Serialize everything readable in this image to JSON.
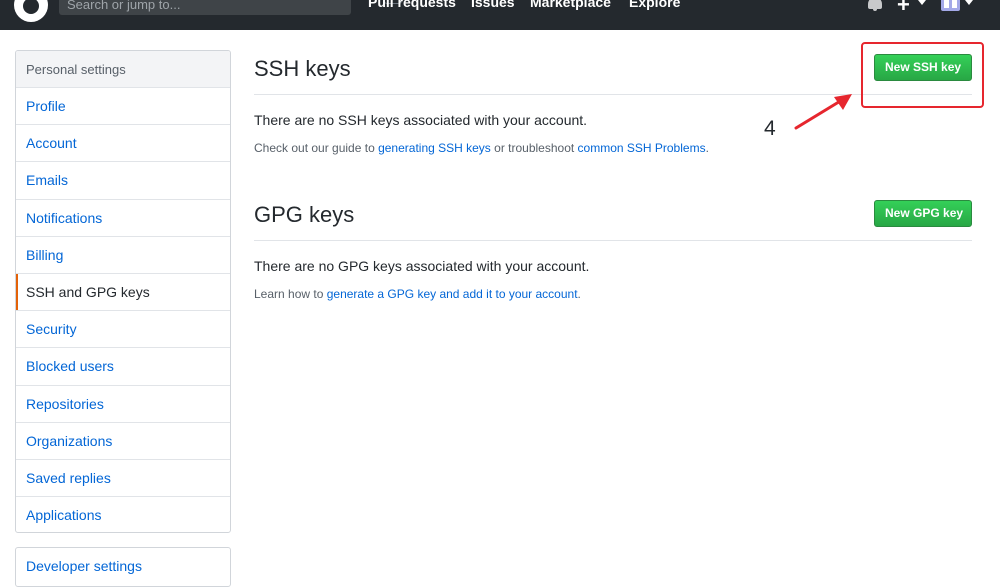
{
  "header": {
    "search": {
      "placeholder": "Search or jump to...",
      "shortcut": "/"
    },
    "nav": [
      "Pull requests",
      "Issues",
      "Marketplace",
      "Explore"
    ]
  },
  "sidebar": {
    "heading": "Personal settings",
    "items": [
      {
        "label": "Profile"
      },
      {
        "label": "Account"
      },
      {
        "label": "Emails"
      },
      {
        "label": "Notifications"
      },
      {
        "label": "Billing"
      },
      {
        "label": "SSH and GPG keys",
        "selected": true
      },
      {
        "label": "Security"
      },
      {
        "label": "Blocked users"
      },
      {
        "label": "Repositories"
      },
      {
        "label": "Organizations"
      },
      {
        "label": "Saved replies"
      },
      {
        "label": "Applications"
      }
    ],
    "developer_settings": "Developer settings"
  },
  "ssh": {
    "title": "SSH keys",
    "button": "New SSH key",
    "blank": "There are no SSH keys associated with your account.",
    "help": {
      "prefix": "Check out our guide to ",
      "link1": "generating SSH keys",
      "middle": " or troubleshoot ",
      "link2": "common SSH Problems",
      "suffix": "."
    }
  },
  "gpg": {
    "title": "GPG keys",
    "button": "New GPG key",
    "blank": "There are no GPG keys associated with your account.",
    "help": {
      "prefix": "Learn how to ",
      "link": "generate a GPG key and add it to your account",
      "suffix": "."
    }
  },
  "annotation": {
    "step": "4",
    "color": "#e6262e"
  },
  "colors": {
    "accent": "#0366d6",
    "button_green": "#28a745",
    "header_bg": "#24292e",
    "selected_marker": "#e36209"
  }
}
